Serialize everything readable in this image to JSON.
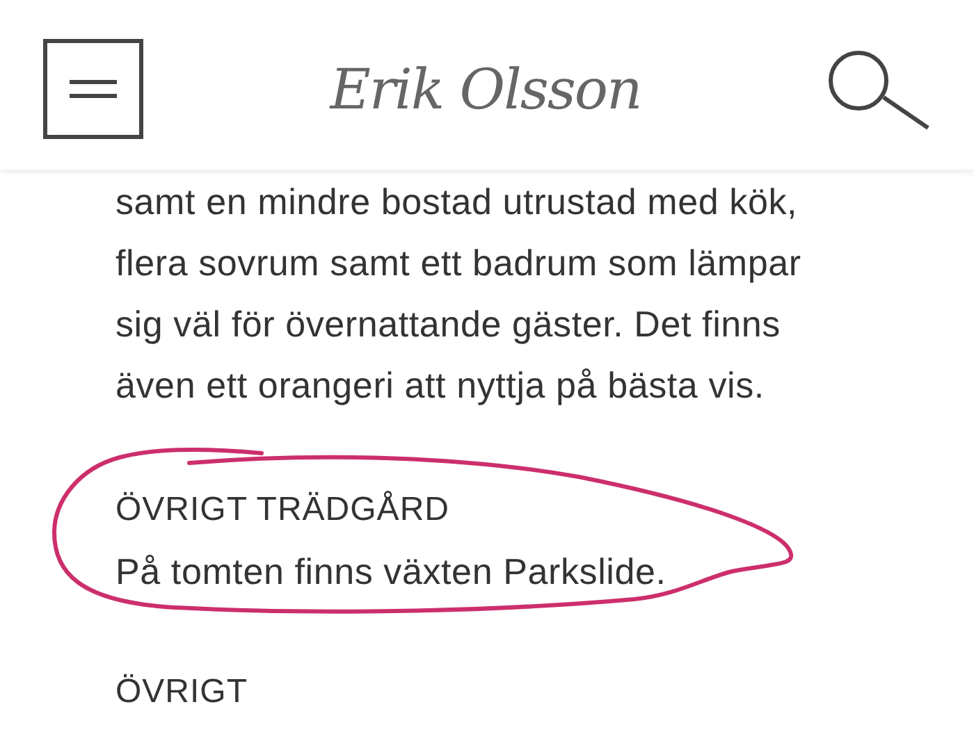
{
  "header": {
    "logo": "Erik Olsson"
  },
  "sections": [
    {
      "lines": [
        "samt en mindre bostad utrustad med kök,",
        "flera sovrum samt ett badrum som lämpar",
        "sig väl för övernattande gäster. Det finns",
        "även ett orangeri att nyttja på bästa vis."
      ],
      "circled": false
    },
    {
      "heading": "ÖVRIGT TRÄDGÅRD",
      "lines": [
        "På tomten finns växten Parkslide."
      ],
      "circled": true
    },
    {
      "heading": "ÖVRIGT",
      "circled": false
    }
  ]
}
